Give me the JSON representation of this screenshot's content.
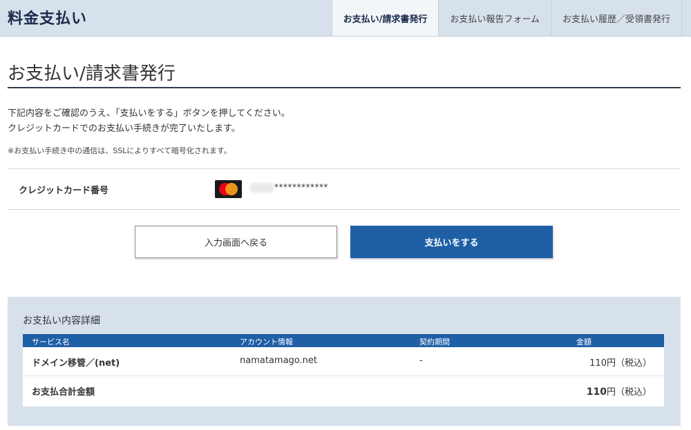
{
  "header": {
    "title": "料金支払い",
    "tabs": [
      {
        "label": "お支払い/請求書発行",
        "active": true
      },
      {
        "label": "お支払い報告フォーム",
        "active": false
      },
      {
        "label": "お支払い履歴／受領書発行",
        "active": false
      }
    ]
  },
  "page": {
    "title": "お支払い/請求書発行",
    "intro_line1": "下記内容をご確認のうえ、「支払いをする」ボタンを押してください。",
    "intro_line2": "クレジットカードでのお支払い手続きが完了いたします。",
    "note": "※お支払い手続き中の通信は、SSLによりすべて暗号化されます。"
  },
  "card": {
    "label": "クレジットカード番号",
    "brand_icon": "mastercard-icon",
    "masked_number": "************"
  },
  "buttons": {
    "back_label": "入力画面へ戻る",
    "pay_label": "支払いをする"
  },
  "details": {
    "title": "お支払い内容詳細",
    "columns": [
      "サービス名",
      "アカウント情報",
      "契約期間",
      "金額"
    ],
    "rows": [
      {
        "service": "ドメイン移管／(net)",
        "account": "namatamago.net",
        "period": "-",
        "amount": "110円（税込）"
      }
    ],
    "total_label": "お支払合計金額",
    "total_amount": "110",
    "total_suffix": "円（税込）"
  },
  "colors": {
    "header_bg": "#d7e1ec",
    "accent_blue": "#1f5fa6",
    "title_rule": "#2f3a4a"
  }
}
